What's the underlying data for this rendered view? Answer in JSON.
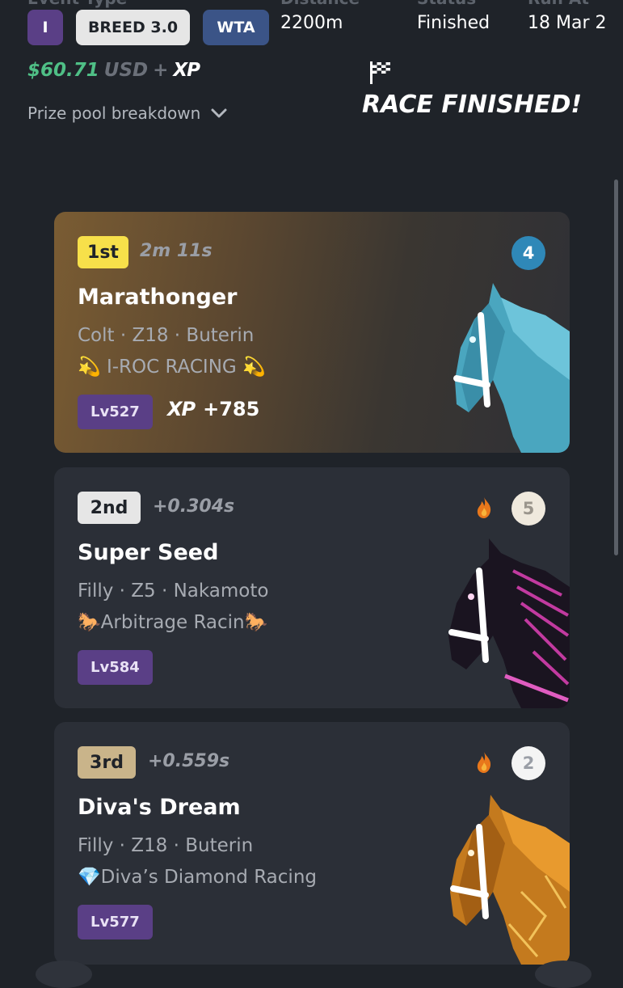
{
  "header": {
    "labels": [
      "Event Type",
      "Distance",
      "Status",
      "Run At"
    ],
    "chips": [
      "I",
      "BREED 3.0",
      "WTA"
    ],
    "distance": "2200m",
    "status": "Finished",
    "run_at": "18 Mar 2"
  },
  "prize": {
    "amount": "$60.71",
    "currency": "USD",
    "plus": "+",
    "xp": "XP"
  },
  "breakdown_label": "Prize pool breakdown",
  "race_status_banner": "RACE FINISHED!",
  "results": [
    {
      "position": "1st",
      "time": "2m 11s",
      "name": "Marathonger",
      "meta": "Colt · Z18 · Buterin",
      "stable": "💫 I-ROC RACING 💫",
      "level": "Lv527",
      "xp_label": "XP",
      "xp_gain": "+785",
      "gate": "4",
      "colors": {
        "card": "#7a5c33",
        "badge": "#f7e04a",
        "gate_bg": "#2f88b8",
        "horse": "#5cb8d0"
      }
    },
    {
      "position": "2nd",
      "time": "+0.304s",
      "name": "Super Seed",
      "meta": "Filly · Z5 · Nakamoto",
      "stable": "🐎Arbitrage Racin🐎",
      "level": "Lv584",
      "gate": "5",
      "colors": {
        "badge": "#e6e6e6",
        "gate_bg": "#efe9dd",
        "horse": "#1a1420"
      }
    },
    {
      "position": "3rd",
      "time": "+0.559s",
      "name": "Diva's Dream",
      "meta": "Filly · Z18 · Buterin",
      "stable": "💎Diva’s Diamond Racing",
      "level": "Lv577",
      "gate": "2",
      "colors": {
        "badge": "#c9b48a",
        "gate_bg": "#f4f4f4",
        "horse": "#c47a1e"
      }
    }
  ],
  "icons": [
    "chevron-down-icon",
    "checkered-flag-icon",
    "fire-icon",
    "horse-image"
  ]
}
